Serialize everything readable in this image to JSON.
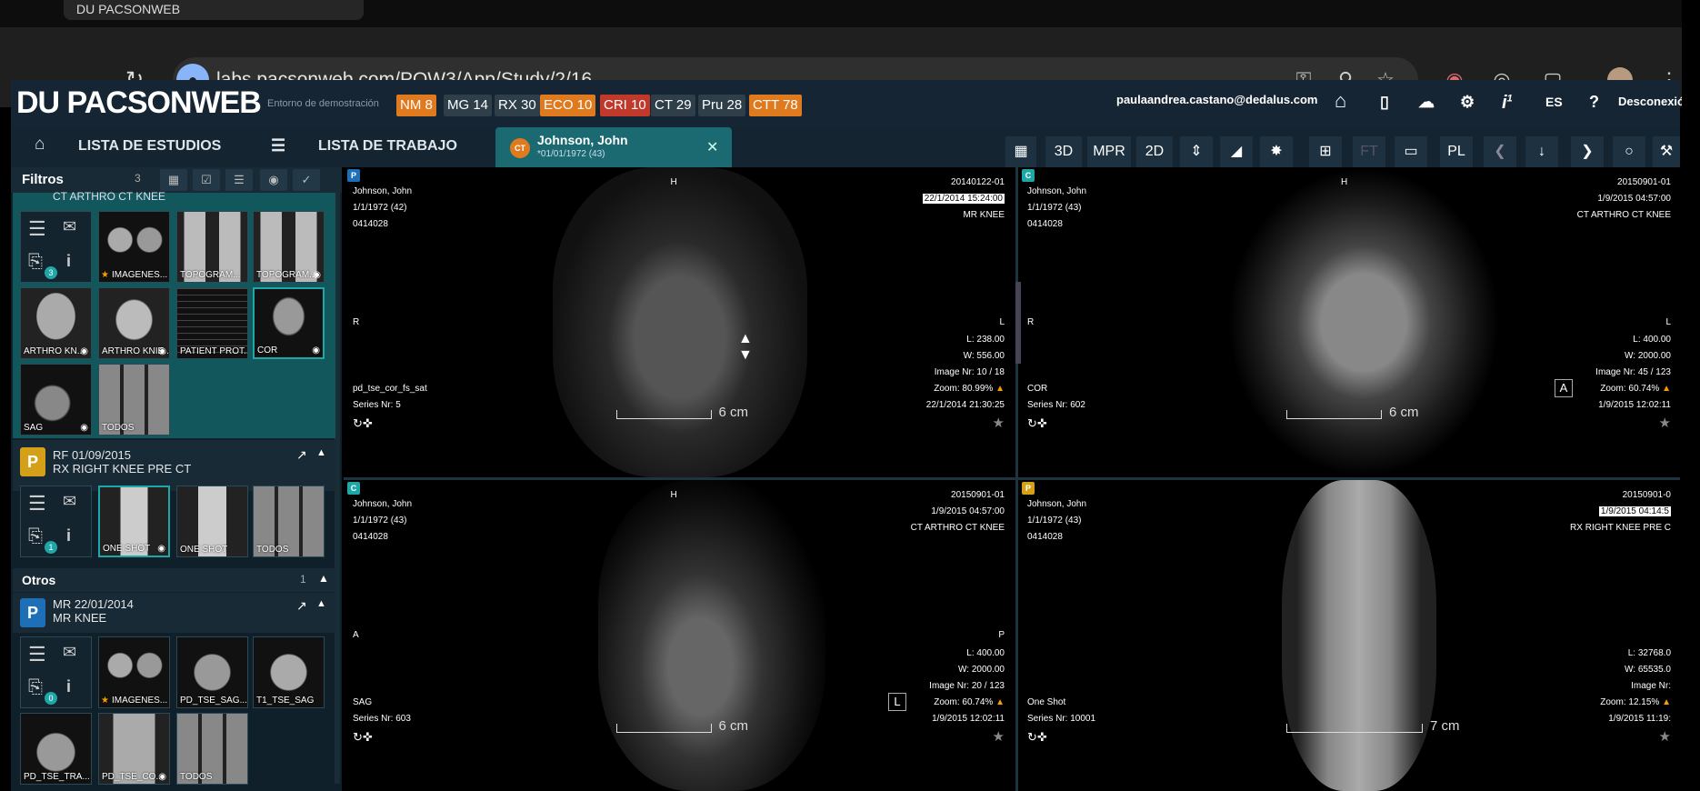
{
  "browser": {
    "tab_title": "DU PACSONWEB",
    "url": "labs.pacsonweb.com/POW3/App/Study/2/16"
  },
  "header": {
    "logo": "DU PACSONWEB",
    "env_label": "Entorno de demostración",
    "badges": [
      {
        "label": "NM 8",
        "color": "#e07a1f"
      },
      {
        "label": "MG 14",
        "color": "#2e3f4a"
      },
      {
        "label": "RX 30",
        "color": "#2e3f4a"
      },
      {
        "label": "ECO 10",
        "color": "#e07a1f"
      },
      {
        "label": "CRI 10",
        "color": "#c0392b"
      },
      {
        "label": "CT 29",
        "color": "#2e3f4a"
      },
      {
        "label": "Pru 28",
        "color": "#2e3f4a"
      },
      {
        "label": "CTT 78",
        "color": "#e07a1f"
      }
    ],
    "user_email": "paulaandrea.castano@dedalus.com",
    "lang": "ES",
    "info_count": "1",
    "logout": "Desconexió"
  },
  "nav": {
    "studies_list": "LISTA DE ESTUDIOS",
    "worklist": "LISTA DE TRABAJO",
    "patient_tab": {
      "badge": "CT",
      "name": "Johnson, John",
      "dob": "*01/01/1972 (43)"
    }
  },
  "toolbar": {
    "btn_3d": "3D",
    "btn_mpr": "MPR",
    "btn_2d": "2D",
    "btn_ft": "FT",
    "btn_pl": "PL"
  },
  "left_panel": {
    "filters_label": "Filtros",
    "filters_count": "3",
    "study1_title": "CT ARTHRO CT KNEE",
    "study1_count": "3",
    "study1_thumbs": [
      "IMAGENES...",
      "TOPOGRAM...",
      "TOPOGRAM...",
      "ARTHRO KN...",
      "ARTHRO KNIE...",
      "PATIENT PROT...",
      "COR",
      "SAG",
      "TODOS"
    ],
    "study2": {
      "badge": "P",
      "date": "RF 01/09/2015",
      "title": "RX RIGHT KNEE PRE CT",
      "count": "1",
      "thumbs": [
        "ONE SHOT",
        "ONE SHOT",
        "TODOS"
      ]
    },
    "others_label": "Otros",
    "others_count": "1",
    "study3": {
      "badge": "P",
      "date": "MR 22/01/2014",
      "title": "MR KNEE",
      "count": "0",
      "thumbs": [
        "IMAGENES...",
        "PD_TSE_SAG...",
        "T1_TSE_SAG",
        "PD_TSE_TRA...",
        "PD_TSE_CO...",
        "TODOS"
      ]
    }
  },
  "viewports": [
    {
      "badge": "P",
      "badge_color": "#1d6fb8",
      "patient": "Johnson, John",
      "dob": "1/1/1972 (42)",
      "id": "0414028",
      "study_id": "20140122-01",
      "datetime": "22/1/2014 15:24:00",
      "desc": "MR KNEE",
      "top": "H",
      "left": "R",
      "right": "L",
      "wl": "L: 238.00",
      "ww": "W: 556.00",
      "image_nr": "Image Nr: 10 / 18",
      "zoom": "Zoom: 80.99%",
      "date2": "22/1/2014 21:30:25",
      "series_desc": "pd_tse_cor_fs_sat",
      "series_nr": "Series Nr: 5",
      "scale": "6 cm"
    },
    {
      "badge": "C",
      "badge_color": "#1fa7a8",
      "patient": "Johnson, John",
      "dob": "1/1/1972 (43)",
      "id": "0414028",
      "study_id": "20150901-01",
      "datetime": "1/9/2015 04:57:00",
      "desc": "CT ARTHRO CT KNEE",
      "top": "H",
      "left": "R",
      "right": "L",
      "wl": "L: 400.00",
      "ww": "W: 2000.00",
      "image_nr": "Image Nr: 45 / 123",
      "zoom": "Zoom: 60.74%",
      "date2": "1/9/2015 12:02:11",
      "series_desc": "COR",
      "series_nr": "Series Nr: 602",
      "scale": "6 cm",
      "view_label": "A"
    },
    {
      "badge": "C",
      "badge_color": "#1fa7a8",
      "patient": "Johnson, John",
      "dob": "1/1/1972 (43)",
      "id": "0414028",
      "study_id": "20150901-01",
      "datetime": "1/9/2015 04:57:00",
      "desc": "CT ARTHRO CT KNEE",
      "top": "H",
      "left": "A",
      "right": "P",
      "wl": "L: 400.00",
      "ww": "W: 2000.00",
      "image_nr": "Image Nr: 20 / 123",
      "zoom": "Zoom: 60.74%",
      "date2": "1/9/2015 12:02:11",
      "series_desc": "SAG",
      "series_nr": "Series Nr: 603",
      "scale": "6 cm",
      "view_label": "L"
    },
    {
      "badge": "P",
      "badge_color": "#d4a017",
      "patient": "Johnson, John",
      "dob": "1/1/1972 (43)",
      "id": "0414028",
      "study_id": "20150901-0",
      "datetime": "1/9/2015 04:14:5",
      "desc": "RX RIGHT KNEE PRE C",
      "wl": "L: 32768.0",
      "ww": "W: 65535.0",
      "image_nr": "Image Nr:",
      "zoom": "Zoom: 12.15%",
      "date2": "1/9/2015 11:19:",
      "series_desc": "One Shot",
      "series_nr": "Series Nr: 10001",
      "scale": "7 cm"
    }
  ]
}
